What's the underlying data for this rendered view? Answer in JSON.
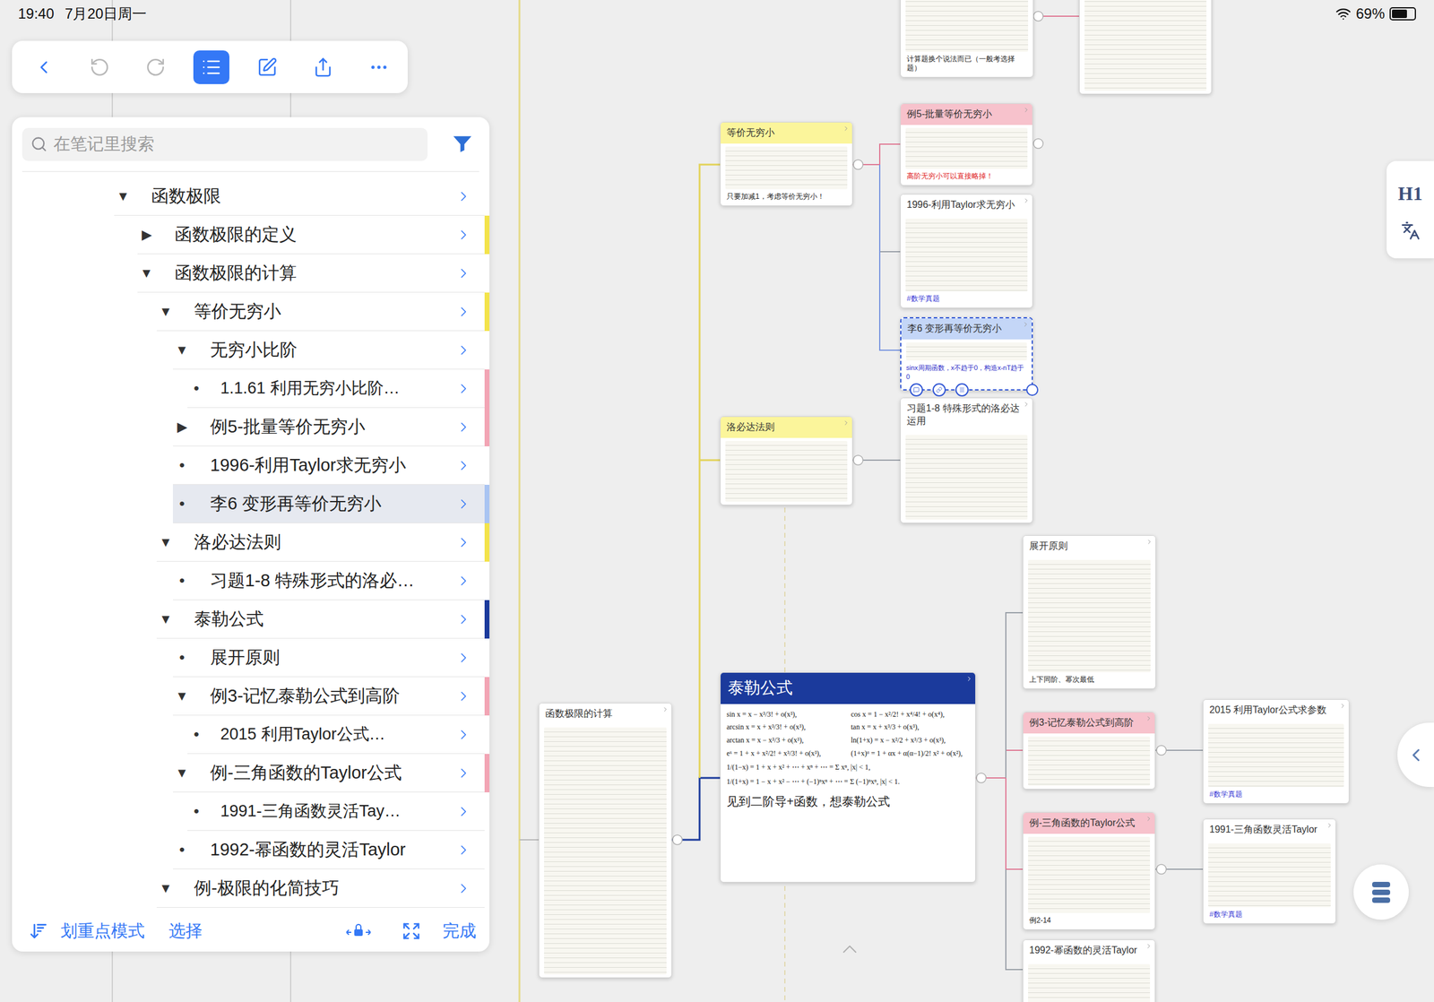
{
  "status_bar": {
    "time": "19:40",
    "date": "7月20日周一",
    "battery_text": "69%",
    "battery_level": 0.69
  },
  "toolbar": [
    {
      "kind": "back",
      "selected": false,
      "disabled": false
    },
    {
      "kind": "undo",
      "selected": false,
      "disabled": true
    },
    {
      "kind": "redo",
      "selected": false,
      "disabled": true
    },
    {
      "kind": "outline",
      "selected": true,
      "disabled": false
    },
    {
      "kind": "edit",
      "selected": false,
      "disabled": false
    },
    {
      "kind": "share",
      "selected": false,
      "disabled": false
    },
    {
      "kind": "more",
      "selected": false,
      "disabled": false
    }
  ],
  "outline": {
    "search_placeholder": "在笔记里搜索",
    "rows": [
      {
        "label": "函数极限",
        "level": 0,
        "marker": "▼",
        "expanded": true,
        "selected": false,
        "color": ""
      },
      {
        "label": "函数极限的定义",
        "level": 1,
        "marker": "▶",
        "expanded": false,
        "selected": false,
        "color": "#f3e34a"
      },
      {
        "label": "函数极限的计算",
        "level": 1,
        "marker": "▼",
        "expanded": true,
        "selected": false,
        "color": ""
      },
      {
        "label": "等价无穷小",
        "level": 2,
        "marker": "▼",
        "expanded": true,
        "selected": false,
        "color": "#f3e34a"
      },
      {
        "label": "无穷小比阶",
        "level": 3,
        "marker": "▼",
        "expanded": true,
        "selected": false,
        "color": ""
      },
      {
        "label": "1.1.61 利用无穷小比阶…",
        "level": 4,
        "marker": "•",
        "selected": false,
        "color": "#f2a4b4"
      },
      {
        "label": "例5-批量等价无穷小",
        "level": 3,
        "marker": "▶",
        "expanded": false,
        "selected": false,
        "color": "#f2a4b4"
      },
      {
        "label": "1996-利用Taylor求无穷小",
        "level": 3,
        "marker": "•",
        "selected": false,
        "color": ""
      },
      {
        "label": "李6 变形再等价无穷小",
        "level": 3,
        "marker": "•",
        "selected": true,
        "color": "#a9c4f2"
      },
      {
        "label": "洛必达法则",
        "level": 2,
        "marker": "▼",
        "expanded": true,
        "selected": false,
        "color": "#f3e34a"
      },
      {
        "label": "习题1-8 特殊形式的洛必…",
        "level": 3,
        "marker": "•",
        "selected": false,
        "color": ""
      },
      {
        "label": "泰勒公式",
        "level": 2,
        "marker": "▼",
        "expanded": true,
        "selected": false,
        "color": "#1b3a9c"
      },
      {
        "label": "展开原则",
        "level": 3,
        "marker": "•",
        "selected": false,
        "color": ""
      },
      {
        "label": "例3-记忆泰勒公式到高阶",
        "level": 3,
        "marker": "▼",
        "expanded": true,
        "selected": false,
        "color": "#f2a4b4"
      },
      {
        "label": "2015 利用Taylor公式…",
        "level": 4,
        "marker": "•",
        "selected": false,
        "color": ""
      },
      {
        "label": "例-三角函数的Taylor公式",
        "level": 3,
        "marker": "▼",
        "expanded": true,
        "selected": false,
        "color": "#f2a4b4"
      },
      {
        "label": "1991-三角函数灵活Tay…",
        "level": 4,
        "marker": "•",
        "selected": false,
        "color": ""
      },
      {
        "label": "1992-幂函数的灵活Taylor",
        "level": 3,
        "marker": "•",
        "selected": false,
        "color": ""
      },
      {
        "label": "例-极限的化简技巧",
        "level": 2,
        "marker": "▼",
        "expanded": true,
        "selected": false,
        "color": ""
      }
    ],
    "bottom_bar": {
      "highlight_mode": "划重点模式",
      "select": "选择",
      "done": "完成"
    }
  },
  "side_panel": {
    "heading_button": "H1"
  },
  "mindmap": {
    "nodes": [
      {
        "title": "",
        "kind": "card",
        "color": "#ffffff",
        "note": "计算题换个说法而已（一般考选择题）",
        "note_color": "#222222",
        "tag": "",
        "selected": false
      },
      {
        "title": "",
        "kind": "card",
        "color": "#ffffff",
        "note": "",
        "note_color": "#222222",
        "tag": "",
        "selected": false
      },
      {
        "title": "等价无穷小",
        "kind": "card",
        "color": "#fbf59b",
        "note": "只要加减1，考虑等价无穷小！",
        "note_color": "#222222",
        "tag": "",
        "selected": false
      },
      {
        "title": "例5-批量等价无穷小",
        "kind": "card",
        "color": "#f7c2cc",
        "note": "高阶无穷小可以直接略掉！",
        "note_color": "#e0201b",
        "tag": "",
        "selected": false
      },
      {
        "title": "1996-利用Taylor求无穷小",
        "kind": "card",
        "color": "#ffffff",
        "note": "",
        "note_color": "#222222",
        "tag": "#数学真题",
        "selected": false
      },
      {
        "title": "李6 变形再等价无穷小",
        "kind": "card",
        "color": "#c4d6f7",
        "note": "sinx周期函数，x不趋于0，构造x-nT趋于0",
        "note_color": "#2a2ac8",
        "tag": "",
        "selected": true
      },
      {
        "title": "习题1-8 特殊形式的洛必达运用",
        "kind": "card",
        "color": "#ffffff",
        "note": "",
        "note_color": "#222222",
        "tag": "",
        "selected": false
      },
      {
        "title": "洛必达法则",
        "kind": "card",
        "color": "#fbf59b",
        "note": "",
        "note_color": "#222222",
        "tag": "",
        "selected": false
      },
      {
        "title": "展开原则",
        "kind": "card",
        "color": "#ffffff",
        "note": "上下同阶、幂次最低",
        "note_color": "#222222",
        "tag": "",
        "selected": false
      },
      {
        "title": "泰勒公式",
        "kind": "formula-card",
        "color": "#1b3a9c",
        "note": "见到二阶导+函数，想泰勒公式",
        "note_color": "#222222",
        "tag": "",
        "selected": false,
        "formulas": [
          "sin x = x − x³/3! + o(x³),",
          "cos x = 1 − x²/2! + x⁴/4! + o(x⁴),",
          "arcsin x = x + x³/3! + o(x³),",
          "tan x = x + x³/3 + o(x³),",
          "arctan x = x − x³/3 + o(x³),",
          "ln(1+x) = x − x²/2 + x³/3 + o(x³),",
          "eˣ = 1 + x + x²/2! + x³/3! + o(x³),",
          "(1+x)ᵅ = 1 + αx + α(α−1)/2! x² + o(x²),"
        ],
        "series": [
          "1/(1−x) = 1 + x + x² + ⋯ + xⁿ + ⋯ = Σ xⁿ, |x| < 1,",
          "1/(1+x) = 1 − x + x² − ⋯ + (−1)ⁿxⁿ + ⋯ = Σ (−1)ⁿxⁿ, |x| < 1."
        ]
      },
      {
        "title": "例3-记忆泰勒公式到高阶",
        "kind": "card",
        "color": "#f7c2cc",
        "note": "",
        "note_color": "#222222",
        "tag": "",
        "selected": false
      },
      {
        "title": "2015 利用Taylor公式求参数",
        "kind": "card",
        "color": "#ffffff",
        "note": "",
        "note_color": "#222222",
        "tag": "#数学真题",
        "selected": false
      },
      {
        "title": "例-三角函数的Taylor公式",
        "kind": "card",
        "color": "#f7c2cc",
        "note": "例2-14",
        "note_color": "#222222",
        "tag": "",
        "selected": false
      },
      {
        "title": "1991-三角函数灵活Taylor",
        "kind": "card",
        "color": "#ffffff",
        "note": "",
        "note_color": "#222222",
        "tag": "#数学真题",
        "selected": false
      },
      {
        "title": "1992-幂函数的灵活Taylor",
        "kind": "card",
        "color": "#ffffff",
        "note": "",
        "note_color": "#222222",
        "tag": "",
        "selected": false
      },
      {
        "title": "函数极限的计算",
        "kind": "card",
        "color": "#ffffff",
        "note": "",
        "note_color": "#222222",
        "tag": "",
        "selected": false
      }
    ]
  }
}
